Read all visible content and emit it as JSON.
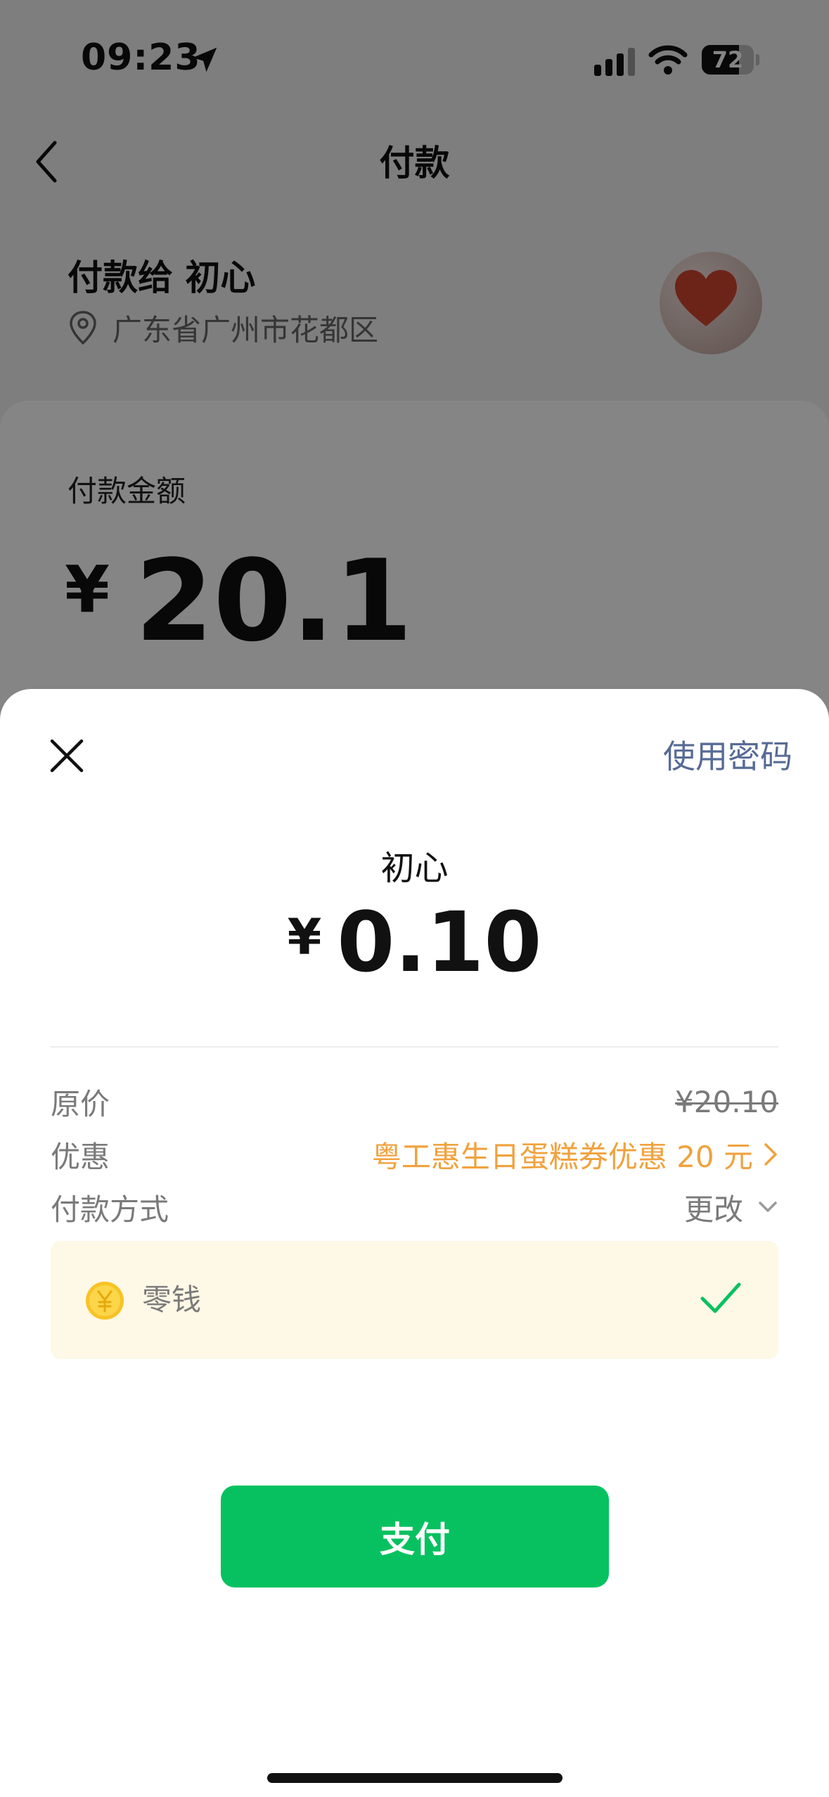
{
  "status_bar": {
    "time": "09:23",
    "battery": "72",
    "battery_fraction": 0.72
  },
  "nav": {
    "title": "付款"
  },
  "payee": {
    "name": "付款给 初心",
    "location": "广东省广州市花都区"
  },
  "amount_card": {
    "label": "付款金额",
    "currency": "¥",
    "amount": "20.1"
  },
  "sheet": {
    "use_password": "使用密码",
    "recipient": "初心",
    "currency": "¥",
    "amount": "0.10",
    "rows": {
      "price_label": "原价",
      "price_value": "¥20.10",
      "discount_label": "优惠",
      "discount_value": "粤工惠生日蛋糕券优惠 20 元",
      "method_label": "付款方式",
      "change_label": "更改"
    },
    "method": {
      "name": "零钱",
      "selected": true
    },
    "pay_button": "支付"
  },
  "colors": {
    "accent_green": "#07c160",
    "link_blue": "#576b95",
    "discount_orange": "#f0a23e",
    "method_bg": "#fef8e6"
  },
  "icons": [
    "location-arrow-icon",
    "signal-icon",
    "wifi-icon",
    "battery-icon",
    "back-icon",
    "location-pin-icon",
    "close-icon",
    "chevron-right-icon",
    "chevron-down-icon",
    "coin-icon",
    "check-icon"
  ]
}
